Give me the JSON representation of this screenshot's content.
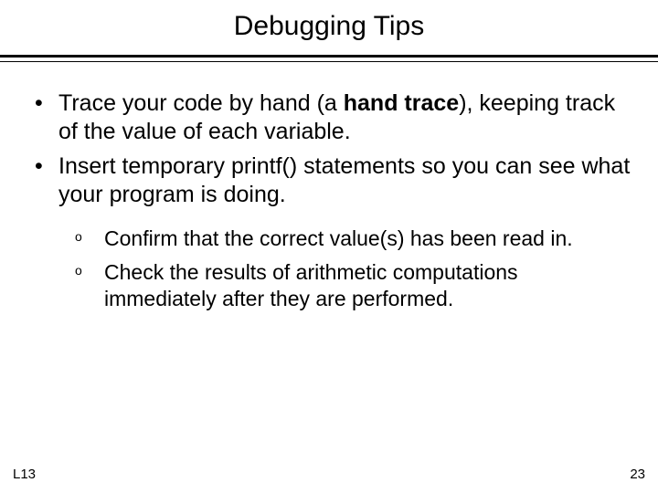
{
  "title": "Debugging Tips",
  "bullets": {
    "b1_pre": "Trace your code by hand (a ",
    "b1_bold": "hand trace",
    "b1_post": "), keeping track of the value of each variable.",
    "b2": "Insert temporary printf() statements so you can see what your program is doing."
  },
  "subbullets": {
    "s1": "Confirm that the correct value(s) has been read in.",
    "s2": "Check the results of arithmetic computations immediately after they are performed."
  },
  "sub_marker": "o",
  "footer": {
    "left": "L13",
    "right": "23"
  }
}
